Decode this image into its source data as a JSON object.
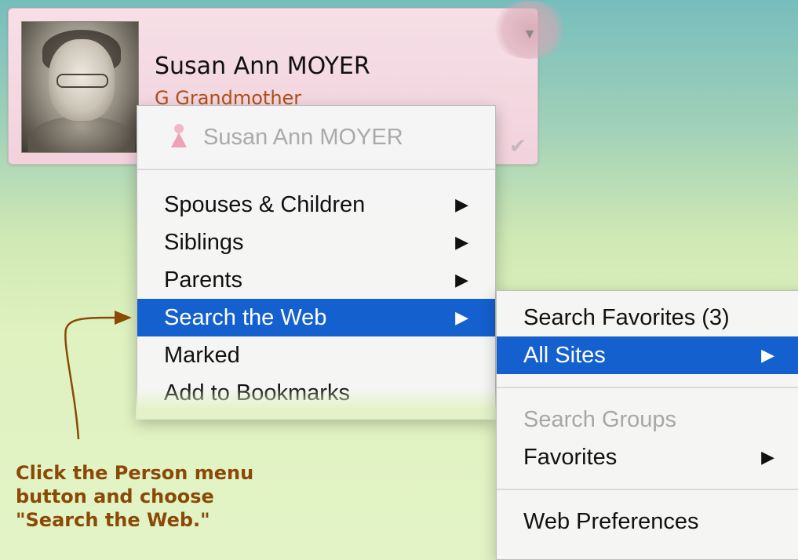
{
  "person": {
    "name": "Susan Ann MOYER",
    "relation": "G Grandmother"
  },
  "person_menu": {
    "header": "Susan Ann MOYER",
    "items": [
      {
        "label": "Spouses & Children",
        "submenu": true,
        "selected": false,
        "disabled": false
      },
      {
        "label": "Siblings",
        "submenu": true,
        "selected": false,
        "disabled": false
      },
      {
        "label": "Parents",
        "submenu": true,
        "selected": false,
        "disabled": false
      },
      {
        "label": "Search the Web",
        "submenu": true,
        "selected": true,
        "disabled": false
      },
      {
        "label": "Marked",
        "submenu": false,
        "selected": false,
        "disabled": false
      },
      {
        "label": "Add to Bookmarks",
        "submenu": false,
        "selected": false,
        "disabled": false
      }
    ]
  },
  "search_submenu": {
    "items": [
      {
        "label": "Search Favorites (3)",
        "submenu": false,
        "selected": false,
        "disabled": false
      },
      {
        "label": "All Sites",
        "submenu": true,
        "selected": true,
        "disabled": false
      },
      {
        "label": "Search Groups",
        "submenu": false,
        "selected": false,
        "disabled": true
      },
      {
        "label": "Favorites",
        "submenu": true,
        "selected": false,
        "disabled": false
      },
      {
        "label": "Web Preferences",
        "submenu": false,
        "selected": false,
        "disabled": false
      }
    ]
  },
  "arrow_glyph": "▶",
  "annotation": {
    "lines": [
      "Click the Person menu",
      "button and choose",
      "\"Search the Web.\""
    ]
  },
  "colors": {
    "selection": "#1460cf",
    "annotation": "#8a4a06",
    "relation": "#b0501a"
  }
}
